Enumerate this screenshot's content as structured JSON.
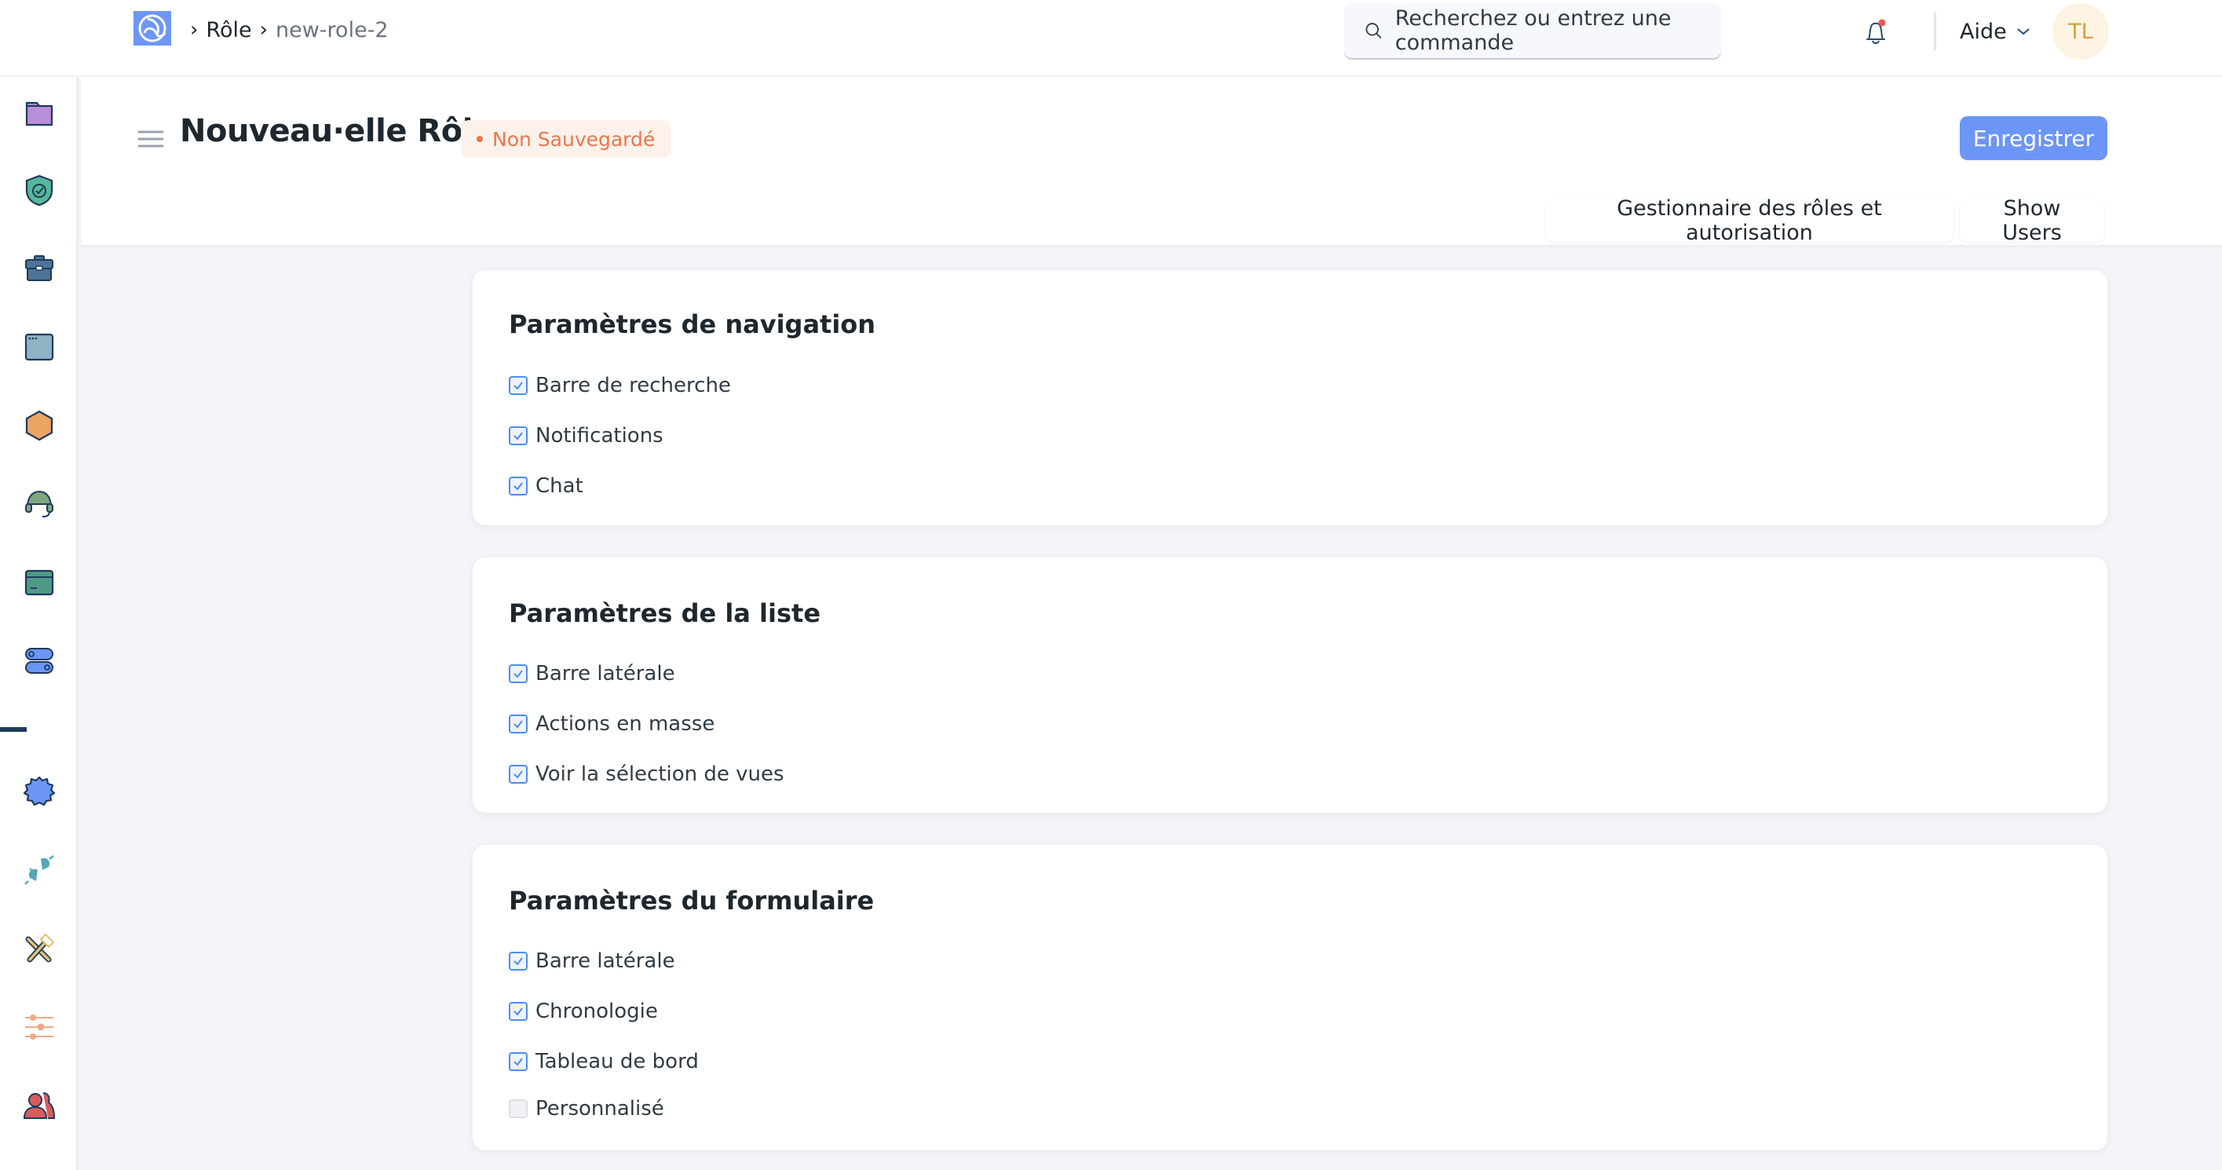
{
  "navbar": {
    "breadcrumbs": [
      {
        "label": "Rôle"
      },
      {
        "label": "new-role-2"
      }
    ],
    "search": {
      "placeholder": "Recherchez ou entrez une commande",
      "value": ""
    },
    "notifications": {
      "has_unread": true
    },
    "help_label": "Aide",
    "avatar_initials": "TL"
  },
  "sidebar": {
    "items": [
      {
        "icon": "folder-icon",
        "color": "#b98fd9"
      },
      {
        "icon": "shield-check-icon",
        "color": "#56b89a"
      },
      {
        "icon": "briefcase-icon",
        "color": "#4f7498"
      },
      {
        "icon": "browser-window-icon",
        "color": "#8fb3c4"
      },
      {
        "icon": "hexagon-icon",
        "color": "#eba461"
      },
      {
        "icon": "headset-icon",
        "color": "#7fa57f"
      },
      {
        "icon": "credit-card-icon",
        "color": "#4f9a87"
      },
      {
        "icon": "toggles-icon",
        "color": "#6c96f5"
      },
      {
        "icon": "gear-icon",
        "color": "#6c96f5"
      },
      {
        "icon": "plug-icon",
        "color": "#56a8b8"
      },
      {
        "icon": "tools-icon",
        "color": "#e4c26f"
      },
      {
        "icon": "sliders-icon",
        "color": "#eda98a"
      },
      {
        "icon": "users-icon",
        "color": "#d95c5c"
      }
    ]
  },
  "page": {
    "title": "Nouveau·elle Rôle",
    "status": "Non Sauvegardé",
    "save_label": "Enregistrer",
    "actions": [
      {
        "label": "Gestionnaire des rôles et autorisation"
      },
      {
        "label": "Show Users"
      }
    ]
  },
  "sections": [
    {
      "title": "Paramètres de navigation",
      "options": [
        {
          "label": "Barre de recherche",
          "checked": true
        },
        {
          "label": "Notifications",
          "checked": true
        },
        {
          "label": "Chat",
          "checked": true
        }
      ]
    },
    {
      "title": "Paramètres de la liste",
      "options": [
        {
          "label": "Barre latérale",
          "checked": true
        },
        {
          "label": "Actions en masse",
          "checked": true
        },
        {
          "label": "Voir la sélection de vues",
          "checked": true
        }
      ]
    },
    {
      "title": "Paramètres du formulaire",
      "options": [
        {
          "label": "Barre latérale",
          "checked": true
        },
        {
          "label": "Chronologie",
          "checked": true
        },
        {
          "label": "Tableau de bord",
          "checked": true
        },
        {
          "label": "Personnalisé",
          "checked": false
        }
      ]
    }
  ]
}
